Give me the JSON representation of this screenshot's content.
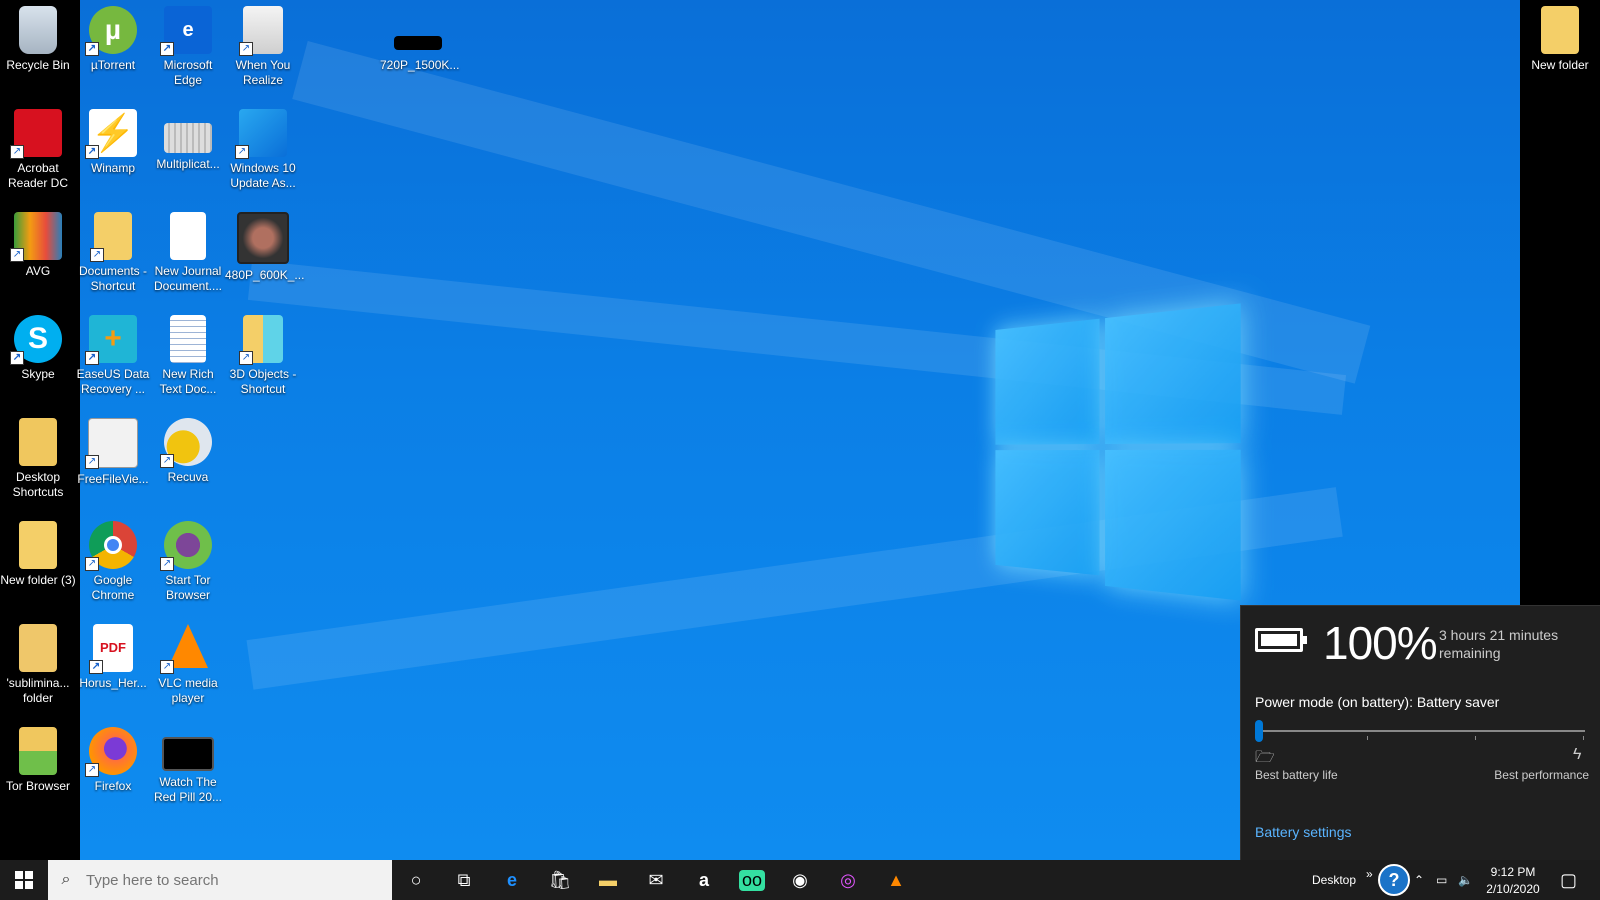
{
  "desktop": {
    "icons_left": [
      {
        "label": "Recycle Bin",
        "icon": "recycle-bin-icon"
      },
      {
        "label": "Acrobat Reader DC",
        "icon": "acrobat-icon"
      },
      {
        "label": "AVG",
        "icon": "avg-icon"
      },
      {
        "label": "Skype",
        "icon": "skype-icon"
      },
      {
        "label": "Desktop Shortcuts",
        "icon": "folder-icon"
      },
      {
        "label": "New folder (3)",
        "icon": "folder-icon"
      },
      {
        "label": "'sublimina... folder",
        "icon": "folder-icon"
      },
      {
        "label": "Tor Browser",
        "icon": "tor-folder-icon"
      }
    ],
    "icons_col2": [
      {
        "label": "µTorrent",
        "icon": "utorrent-icon"
      },
      {
        "label": "Winamp",
        "icon": "winamp-icon"
      },
      {
        "label": "Documents - Shortcut",
        "icon": "folder-icon"
      },
      {
        "label": "EaseUS Data Recovery ...",
        "icon": "easeus-icon"
      },
      {
        "label": "FreeFileVie...",
        "icon": "freefileviewer-icon"
      },
      {
        "label": "Google Chrome",
        "icon": "chrome-icon"
      },
      {
        "label": "Horus_Her...",
        "icon": "pdf-icon"
      },
      {
        "label": "Firefox",
        "icon": "firefox-icon"
      }
    ],
    "icons_col3": [
      {
        "label": "Microsoft Edge",
        "icon": "edge-icon"
      },
      {
        "label": "Multiplicat...",
        "icon": "file-icon"
      },
      {
        "label": "New Journal Document....",
        "icon": "document-icon"
      },
      {
        "label": "New Rich Text Doc...",
        "icon": "rtf-document-icon"
      },
      {
        "label": "Recuva",
        "icon": "recuva-icon"
      },
      {
        "label": "Start Tor Browser",
        "icon": "tor-icon"
      },
      {
        "label": "VLC media player",
        "icon": "vlc-icon"
      },
      {
        "label": "Watch The Red Pill 20...",
        "icon": "video-icon"
      }
    ],
    "icons_col4": [
      {
        "label": "When You Realize",
        "icon": "gradient-file-icon"
      },
      {
        "label": "Windows 10 Update As...",
        "icon": "windows-update-icon"
      },
      {
        "label": "480P_600K_...",
        "icon": "video-icon"
      },
      {
        "label": "3D Objects - Shortcut",
        "icon": "folder-icon"
      }
    ],
    "icon_720": {
      "label": "720P_1500K...",
      "icon": "video-icon"
    },
    "icon_right": {
      "label": "New folder",
      "icon": "folder-icon"
    }
  },
  "battery_flyout": {
    "percent": "100%",
    "remaining": "3 hours 21 minutes remaining",
    "power_mode": "Power mode (on battery): Battery saver",
    "slider_level": 0,
    "best_battery_label": "Best battery life",
    "best_performance_label": "Best performance",
    "settings_link": "Battery settings"
  },
  "taskbar": {
    "search_placeholder": "Type here to search",
    "desktop_label": "Desktop",
    "time": "9:12 PM",
    "date": "2/10/2020",
    "pinned": [
      "cortana-icon",
      "task-view-icon",
      "edge-icon",
      "store-icon",
      "file-explorer-icon",
      "mail-icon",
      "amazon-icon",
      "tripadvisor-icon",
      "app-icon",
      "app-icon",
      "vlc-icon"
    ]
  },
  "colors": {
    "accent": "#0078d7",
    "taskbar": "#1c1c1c",
    "flyout": "#1f1f1f"
  }
}
